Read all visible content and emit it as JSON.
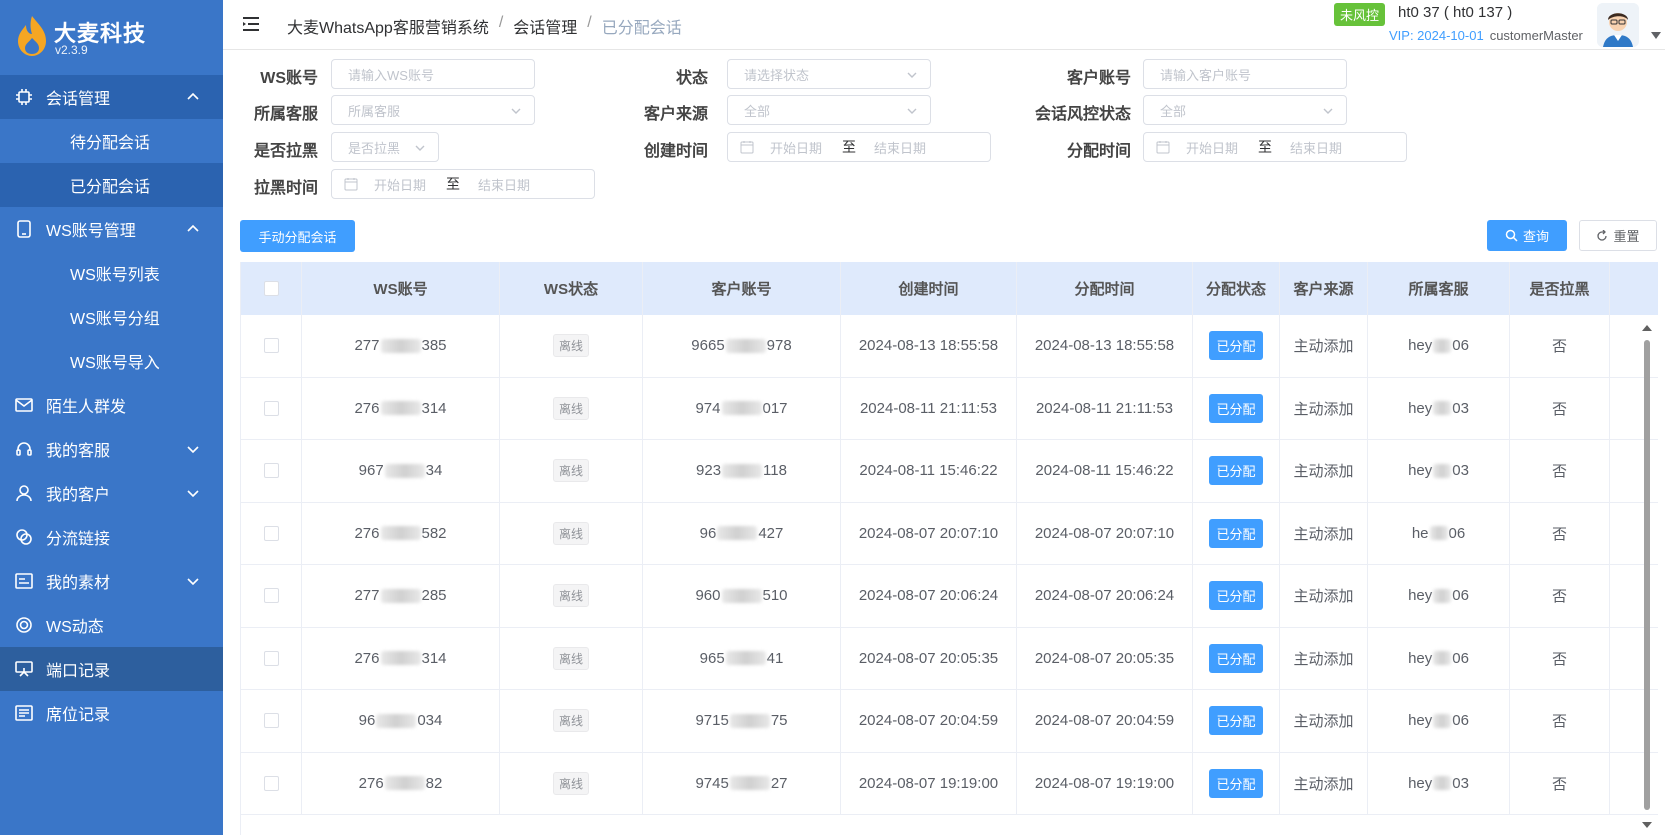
{
  "app": {
    "title": "大麦科技",
    "version": "v2.3.9"
  },
  "sidebar": {
    "items": [
      {
        "label": "会话管理",
        "icon": "chip-icon",
        "expanded": true
      },
      {
        "label": "待分配会话",
        "sub": true
      },
      {
        "label": "已分配会话",
        "sub": true,
        "current": true
      },
      {
        "label": "WS账号管理",
        "icon": "phone-icon",
        "expanded": true
      },
      {
        "label": "WS账号列表",
        "sub": true
      },
      {
        "label": "WS账号分组",
        "sub": true
      },
      {
        "label": "WS账号导入",
        "sub": true
      },
      {
        "label": "陌生人群发",
        "icon": "mail-icon"
      },
      {
        "label": "我的客服",
        "icon": "headset-icon",
        "collapsed": true
      },
      {
        "label": "我的客户",
        "icon": "user-icon",
        "collapsed": true
      },
      {
        "label": "分流链接",
        "icon": "link-icon"
      },
      {
        "label": "我的素材",
        "icon": "material-icon",
        "collapsed": true
      },
      {
        "label": "WS动态",
        "icon": "ring-icon"
      },
      {
        "label": "端口记录",
        "icon": "board-icon",
        "highlight": true
      },
      {
        "label": "席位记录",
        "icon": "list-icon"
      }
    ]
  },
  "header": {
    "breadcrumb": [
      "大麦WhatsApp客服营销系统",
      "会话管理",
      "已分配会话"
    ],
    "risk_badge": "未风控",
    "account": "ht0      37 ( ht0      137 )",
    "vip": "VIP: 2024-10-01",
    "role": "customerMaster"
  },
  "filters": {
    "ws_account": {
      "label": "WS账号",
      "placeholder": "请输入WS账号"
    },
    "status": {
      "label": "状态",
      "placeholder": "请选择状态"
    },
    "customer_account": {
      "label": "客户账号",
      "placeholder": "请输入客户账号"
    },
    "agent": {
      "label": "所属客服",
      "placeholder": "所属客服"
    },
    "source": {
      "label": "客户来源",
      "value": "全部"
    },
    "risk_status": {
      "label": "会话风控状态",
      "value": "全部"
    },
    "blacklisted": {
      "label": "是否拉黑",
      "placeholder": "是否拉黑"
    },
    "created_time": {
      "label": "创建时间",
      "start": "开始日期",
      "to": "至",
      "end": "结束日期"
    },
    "assigned_time": {
      "label": "分配时间",
      "start": "开始日期",
      "to": "至",
      "end": "结束日期"
    },
    "blacklist_time": {
      "label": "拉黑时间",
      "start": "开始日期",
      "to": "至",
      "end": "结束日期"
    }
  },
  "actions": {
    "assign": "手动分配会话",
    "query": "查询",
    "reset": "重置"
  },
  "table": {
    "headers": [
      "WS账号",
      "WS状态",
      "客户账号",
      "创建时间",
      "分配时间",
      "分配状态",
      "客户来源",
      "所属客服",
      "是否拉黑"
    ],
    "rows": [
      {
        "ws_a": "277",
        "ws_b": "385",
        "status": "离线",
        "cust_a": "9665",
        "cust_b": "978",
        "created": "2024-08-13 18:55:58",
        "assigned": "2024-08-13 18:55:58",
        "assign_status": "已分配",
        "source": "主动添加",
        "agent_a": "hey",
        "agent_b": "06",
        "black": "否"
      },
      {
        "ws_a": "276",
        "ws_b": "314",
        "status": "离线",
        "cust_a": "974",
        "cust_b": "017",
        "created": "2024-08-11 21:11:53",
        "assigned": "2024-08-11 21:11:53",
        "assign_status": "已分配",
        "source": "主动添加",
        "agent_a": "hey",
        "agent_b": "03",
        "black": "否"
      },
      {
        "ws_a": "967",
        "ws_b": "34",
        "status": "离线",
        "cust_a": "923",
        "cust_b": "118",
        "created": "2024-08-11 15:46:22",
        "assigned": "2024-08-11 15:46:22",
        "assign_status": "已分配",
        "source": "主动添加",
        "agent_a": "hey",
        "agent_b": "03",
        "black": "否"
      },
      {
        "ws_a": "276",
        "ws_b": "582",
        "status": "离线",
        "cust_a": "96",
        "cust_b": "427",
        "created": "2024-08-07 20:07:10",
        "assigned": "2024-08-07 20:07:10",
        "assign_status": "已分配",
        "source": "主动添加",
        "agent_a": "he",
        "agent_b": "06",
        "black": "否"
      },
      {
        "ws_a": "277",
        "ws_b": "285",
        "status": "离线",
        "cust_a": "960",
        "cust_b": "510",
        "created": "2024-08-07 20:06:24",
        "assigned": "2024-08-07 20:06:24",
        "assign_status": "已分配",
        "source": "主动添加",
        "agent_a": "hey",
        "agent_b": "06",
        "black": "否"
      },
      {
        "ws_a": "276",
        "ws_b": "314",
        "status": "离线",
        "cust_a": "965",
        "cust_b": "41",
        "created": "2024-08-07 20:05:35",
        "assigned": "2024-08-07 20:05:35",
        "assign_status": "已分配",
        "source": "主动添加",
        "agent_a": "hey",
        "agent_b": "06",
        "black": "否"
      },
      {
        "ws_a": "96",
        "ws_b": "034",
        "status": "离线",
        "cust_a": "9715",
        "cust_b": "75",
        "created": "2024-08-07 20:04:59",
        "assigned": "2024-08-07 20:04:59",
        "assign_status": "已分配",
        "source": "主动添加",
        "agent_a": "hey",
        "agent_b": "06",
        "black": "否"
      },
      {
        "ws_a": "276",
        "ws_b": "82",
        "status": "离线",
        "cust_a": "9745",
        "cust_b": "27",
        "created": "2024-08-07 19:19:00",
        "assigned": "2024-08-07 19:19:00",
        "assign_status": "已分配",
        "source": "主动添加",
        "agent_a": "hey",
        "agent_b": "03",
        "black": "否"
      }
    ]
  },
  "colors": {
    "sidebar": "#3a76c8",
    "accent": "#409eff",
    "success": "#67c23a",
    "header_row": "#dfeafc"
  }
}
